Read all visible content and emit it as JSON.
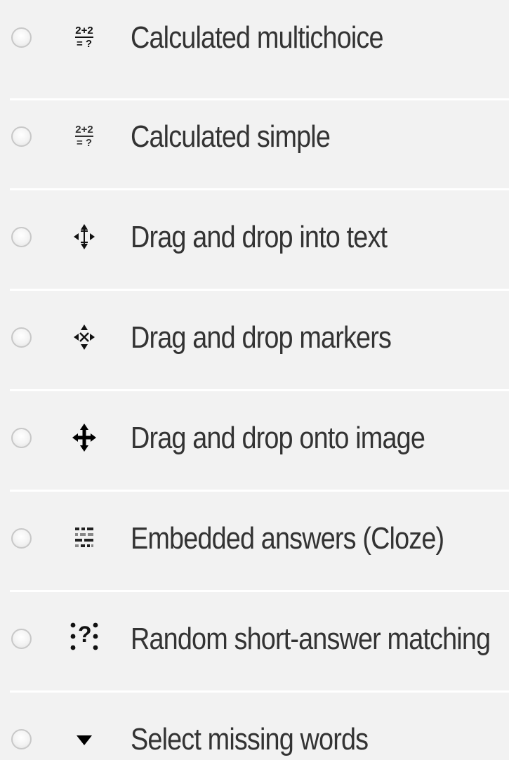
{
  "options": [
    {
      "label": "Calculated multichoice",
      "icon": "calculated-multichoice-icon",
      "icon_text_top": "2+2",
      "icon_text_bottom": "= ?"
    },
    {
      "label": "Calculated simple",
      "icon": "calculated-simple-icon",
      "icon_text_top": "2+2",
      "icon_text_bottom": "= ?"
    },
    {
      "label": "Drag and drop into text",
      "icon": "drag-drop-text-icon"
    },
    {
      "label": "Drag and drop markers",
      "icon": "drag-drop-markers-icon"
    },
    {
      "label": "Drag and drop onto image",
      "icon": "drag-drop-image-icon"
    },
    {
      "label": "Embedded answers (Cloze)",
      "icon": "cloze-icon"
    },
    {
      "label": "Random short-answer matching",
      "icon": "random-short-answer-icon",
      "icon_text": "?"
    },
    {
      "label": "Select missing words",
      "icon": "select-missing-words-icon"
    }
  ],
  "colors": {
    "background": "#f2f2f2",
    "divider": "#ffffff",
    "text": "#333333",
    "radio_border": "#c8c8c8"
  }
}
